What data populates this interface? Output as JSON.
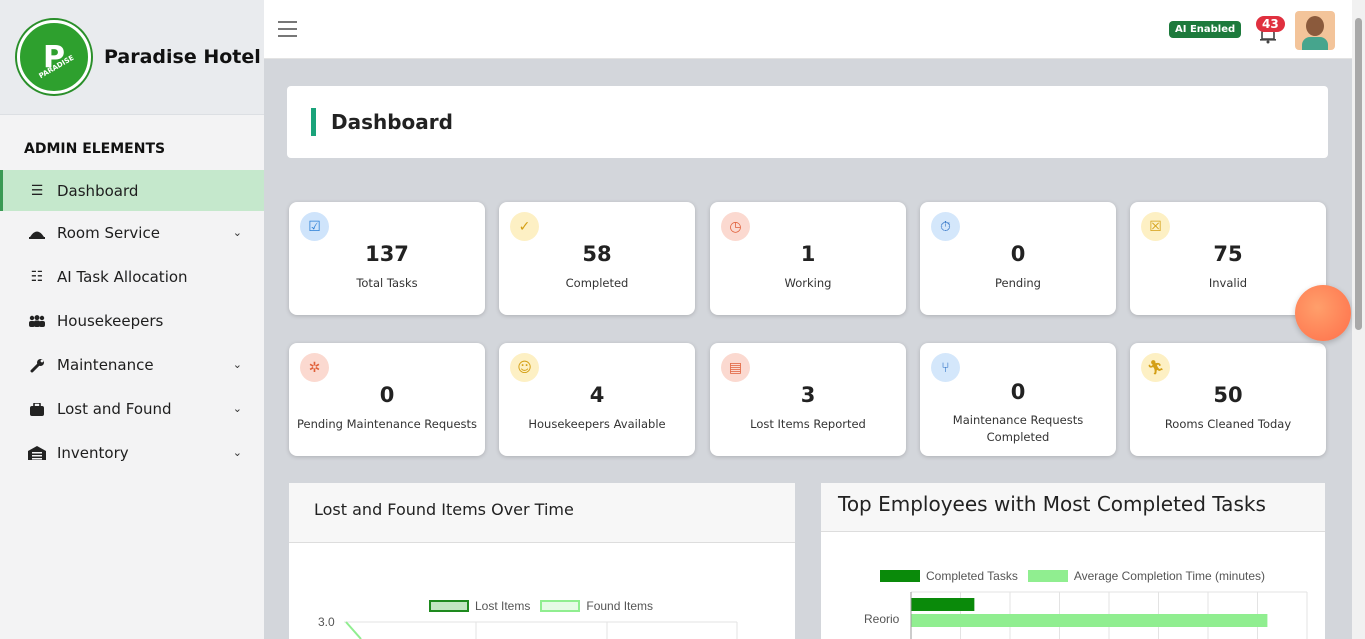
{
  "brand": {
    "name": "Paradise Hotel",
    "logo_letter": "P",
    "logo_text": "PARADISE"
  },
  "sidebar": {
    "section_title": "ADMIN ELEMENTS",
    "items": [
      {
        "label": "Dashboard",
        "icon": "list-icon",
        "active": true
      },
      {
        "label": "Room Service",
        "icon": "cloche-icon",
        "has_submenu": true
      },
      {
        "label": "AI Task Allocation",
        "icon": "checklist-icon"
      },
      {
        "label": "Housekeepers",
        "icon": "people-icon"
      },
      {
        "label": "Maintenance",
        "icon": "wrench-icon",
        "has_submenu": true
      },
      {
        "label": "Lost and Found",
        "icon": "briefcase-icon",
        "has_submenu": true
      },
      {
        "label": "Inventory",
        "icon": "warehouse-icon",
        "has_submenu": true
      }
    ]
  },
  "topbar": {
    "ai_badge": "AI Enabled",
    "notification_count": "43"
  },
  "page_title": "Dashboard",
  "stats": [
    {
      "value": "137",
      "label": "Total Tasks",
      "icon": "clipboard-check-icon",
      "color": "#cfe4fb"
    },
    {
      "value": "58",
      "label": "Completed",
      "icon": "user-check-icon",
      "color": "#fdf0c4"
    },
    {
      "value": "1",
      "label": "Working",
      "icon": "clock-icon",
      "color": "#fbd9d0"
    },
    {
      "value": "0",
      "label": "Pending",
      "icon": "stopwatch-icon",
      "color": "#d4e7fb"
    },
    {
      "value": "75",
      "label": "Invalid",
      "icon": "clipboard-x-icon",
      "color": "#fdf0c4"
    },
    {
      "value": "0",
      "label": "Pending Maintenance Requests",
      "icon": "spinner-icon",
      "color": "#fbd9d0"
    },
    {
      "value": "4",
      "label": "Housekeepers Available",
      "icon": "user-icon",
      "color": "#fdf0c4"
    },
    {
      "value": "3",
      "label": "Lost Items Reported",
      "icon": "report-icon",
      "color": "#fbd9d0"
    },
    {
      "value": "0",
      "label": "Maintenance Requests Completed",
      "icon": "merge-icon",
      "color": "#d4e7fb"
    },
    {
      "value": "50",
      "label": "Rooms Cleaned Today",
      "icon": "running-icon",
      "color": "#fdf0c4"
    }
  ],
  "charts": {
    "lost_found": {
      "title": "Lost and Found Items Over Time",
      "legend": [
        "Lost Items",
        "Found Items"
      ],
      "colors": [
        "#1e8a1e",
        "#90ee90"
      ],
      "y_tick_top": "3.0"
    },
    "top_employees": {
      "title": "Top Employees with Most Completed Tasks",
      "legend": [
        "Completed Tasks",
        "Average Completion Time (minutes)"
      ],
      "colors": [
        "#0a8a0a",
        "#90ee90"
      ],
      "first_category": "Reorio"
    }
  },
  "chart_data": [
    {
      "type": "line",
      "title": "Lost and Found Items Over Time",
      "series": [
        {
          "name": "Lost Items"
        },
        {
          "name": "Found Items"
        }
      ],
      "y_ticks_visible": [
        "3.0"
      ]
    },
    {
      "type": "bar",
      "title": "Top Employees with Most Completed Tasks",
      "orientation": "horizontal",
      "categories": [
        "Reorio"
      ],
      "series": [
        {
          "name": "Completed Tasks",
          "values": [
            64
          ]
        },
        {
          "name": "Average Completion Time (minutes)",
          "values": [
            360
          ]
        }
      ]
    }
  ]
}
